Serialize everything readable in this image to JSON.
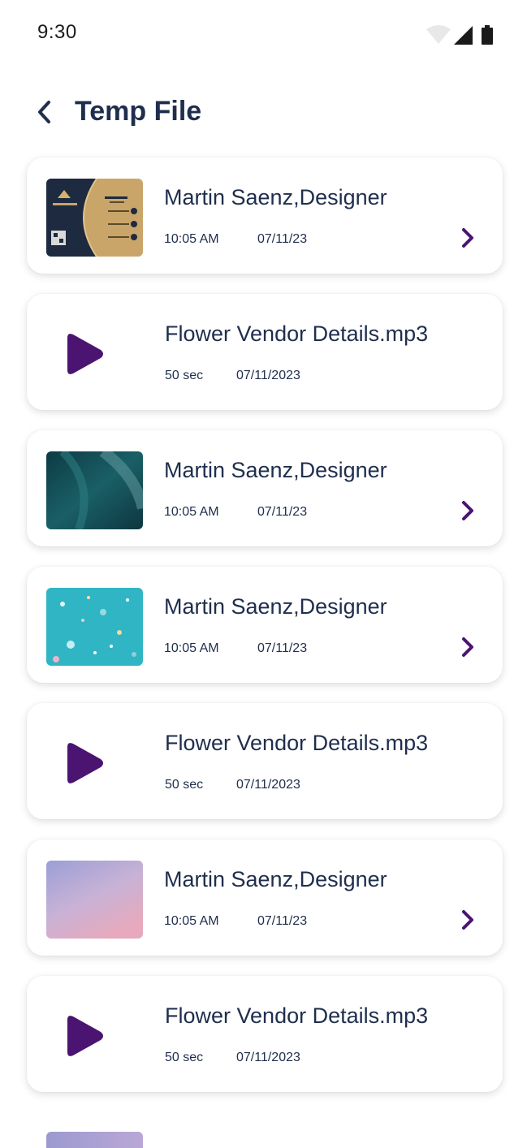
{
  "status_bar": {
    "time": "9:30",
    "icons": [
      "wifi-icon",
      "signal-icon",
      "battery-icon"
    ]
  },
  "header": {
    "back_icon": "chevron-left-icon",
    "title": "Temp File"
  },
  "colors": {
    "accent": "#4a1470",
    "text": "#1f2e4d",
    "card_bg": "#ffffff"
  },
  "items": [
    {
      "type": "image",
      "thumbnail": "business-card",
      "title": "Martin Saenz,Designer",
      "time": "10:05 AM",
      "date": "07/11/23"
    },
    {
      "type": "audio",
      "title": "Flower Vendor Details.mp3",
      "duration": "50 sec",
      "date": "07/11/2023"
    },
    {
      "type": "image",
      "thumbnail": "dark-teal-texture",
      "title": "Martin Saenz,Designer",
      "time": "10:05 AM",
      "date": "07/11/23"
    },
    {
      "type": "image",
      "thumbnail": "turquoise-speckled",
      "title": "Martin Saenz,Designer",
      "time": "10:05 AM",
      "date": "07/11/23"
    },
    {
      "type": "audio",
      "title": "Flower Vendor Details.mp3",
      "duration": "50 sec",
      "date": "07/11/2023"
    },
    {
      "type": "image",
      "thumbnail": "pastel-gradient",
      "title": "Martin Saenz,Designer",
      "time": "10:05 AM",
      "date": "07/11/23"
    },
    {
      "type": "audio",
      "title": "Flower Vendor Details.mp3",
      "duration": "50 sec",
      "date": "07/11/2023"
    }
  ]
}
